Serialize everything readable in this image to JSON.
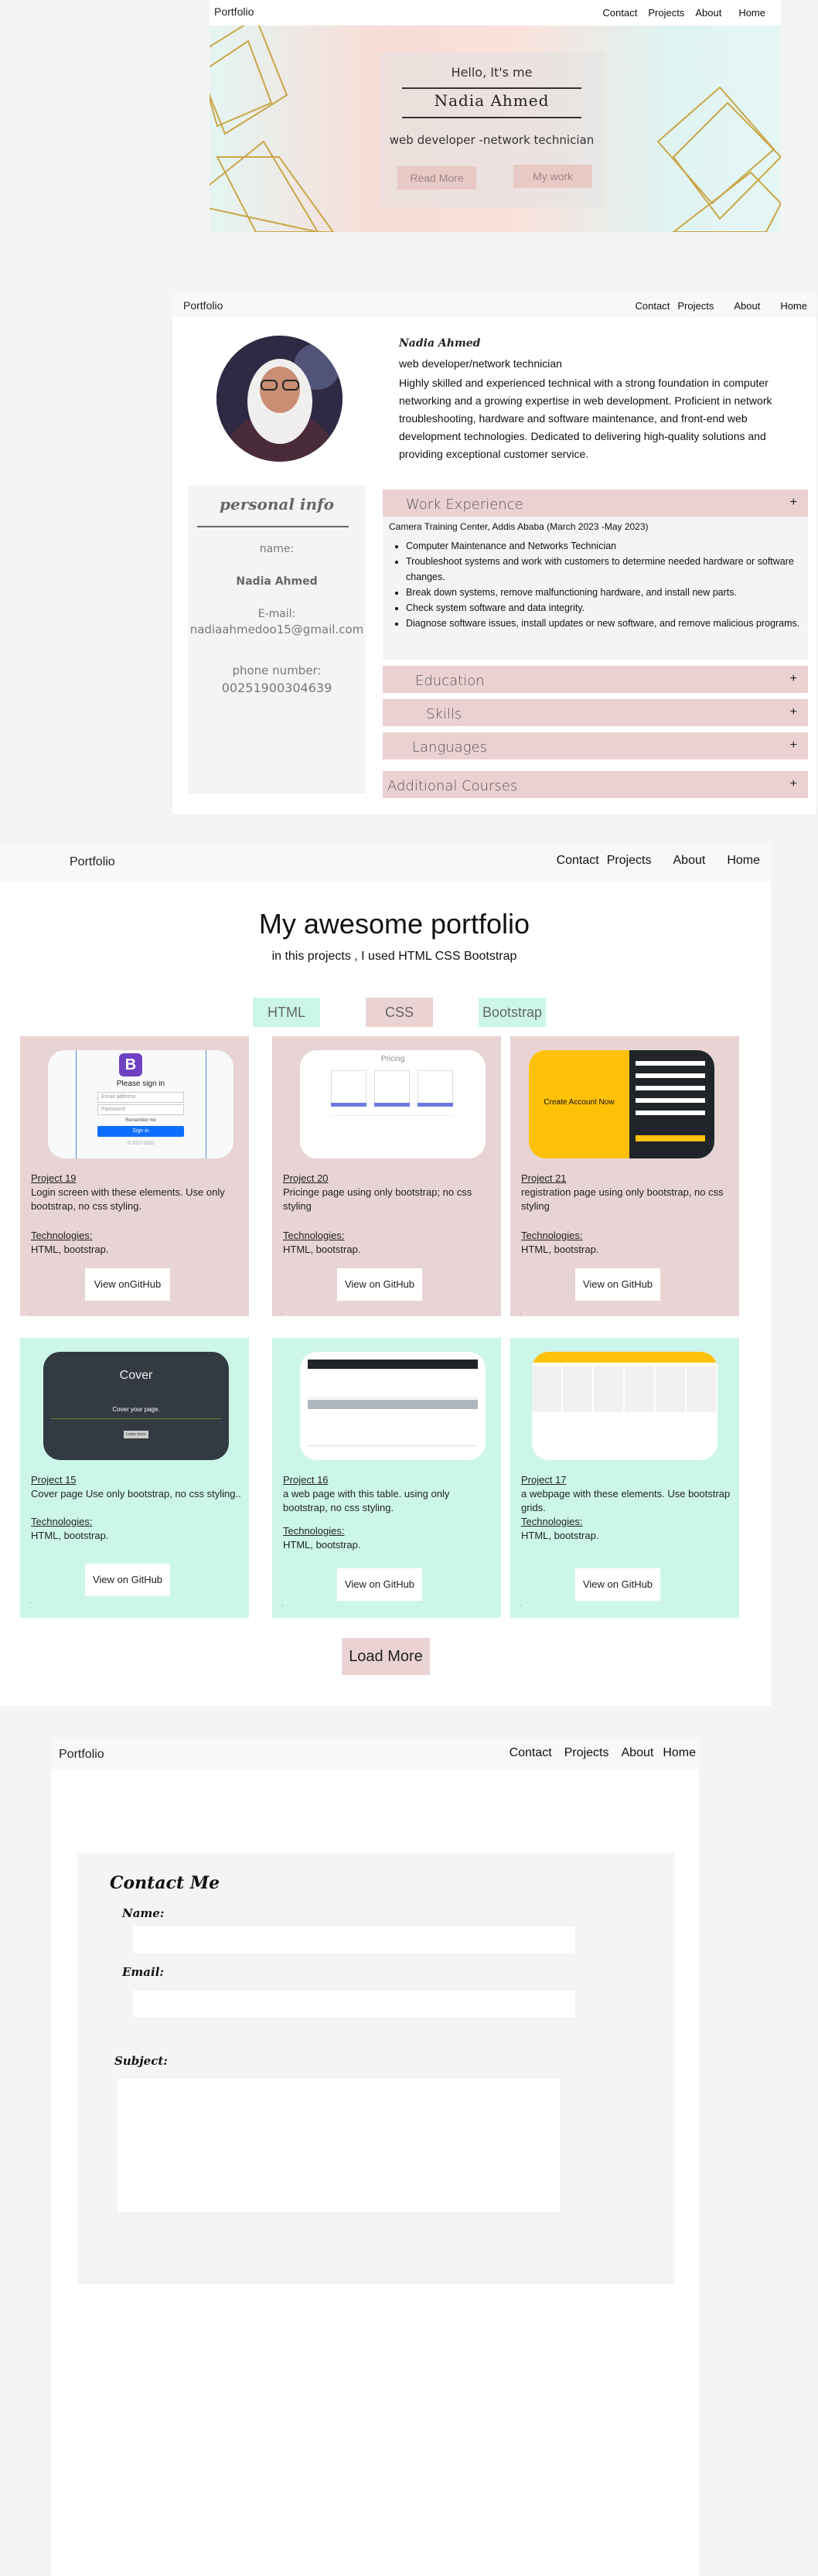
{
  "hero": {
    "brand": "Portfolio",
    "nav": [
      "Contact",
      "Projects",
      "About",
      "Home"
    ],
    "greeting": "Hello, It's me",
    "name": "Nadia Ahmed",
    "role": "web developer -network technician",
    "read_more": "Read More",
    "my_work": "My work"
  },
  "about": {
    "brand": "Portfolio",
    "nav": [
      "Contact",
      "Projects",
      "About",
      "Home"
    ],
    "name": "Nadia Ahmed",
    "role": "web developer/network technician",
    "bio": "Highly skilled and experienced technical with a strong foundation in computer networking and a growing expertise in web development. Proficient in network troubleshooting, hardware and software maintenance, and front-end web development technologies. Dedicated to delivering high-quality solutions and providing exceptional customer service.",
    "personal_info_title": "personal info",
    "name_label": "name:",
    "name_value": "Nadia Ahmed",
    "email_label": "E-mail:",
    "email_value": "nadiaahmedoo15@gmail.com",
    "phone_label": "phone number:",
    "phone_value": "00251900304639",
    "accordions": {
      "work": "Work Experience",
      "education": "Education",
      "skills": "Skills",
      "languages": "Languages",
      "courses": "Additional Courses",
      "plus": "+"
    },
    "work_heading": "Camera Training Center, Addis Ababa (March 2023 -May 2023)",
    "work_items": [
      "Computer Maintenance and Networks Technician",
      "Troubleshoot systems and work with customers to determine needed hardware or software changes.",
      "Break down systems, remove malfunctioning hardware, and install new parts.",
      "Check system software and data integrity.",
      "Diagnose software issues, install updates or new software, and remove malicious programs."
    ]
  },
  "portfolio": {
    "brand": "Portfolio",
    "nav": [
      "Contact",
      "Projects",
      "About",
      "Home"
    ],
    "title": "My awesome portfolio",
    "subtitle": "in this projects , I used HTML CSS  Bootstrap",
    "tabs": [
      "HTML",
      "CSS",
      "Bootstrap"
    ],
    "tech_label": "Technologies:",
    "tech_value": "HTML,  bootstrap.",
    "github_label": "View on GitHub",
    "github_label_first": "View onGitHub",
    "projects": [
      {
        "title": "Project 19",
        "desc": " Login screen with these elements. Use only bootstrap, no css styling."
      },
      {
        "title": "Project 20",
        "desc": "Pricinge page using only bootstrap; no css styling"
      },
      {
        "title": "Project 21",
        "desc": "registration page using only bootstrap, no css styling"
      },
      {
        "title": "Project 15",
        "desc": "Cover  page Use only bootstrap, no css styling.."
      },
      {
        "title": "Project 16",
        "desc": "a web page with this table. using only bootstrap, no css styling."
      },
      {
        "title": "Project 17",
        "desc": "a webpage with these elements. Use bootstrap grids."
      }
    ],
    "load_more": "Load More",
    "shots": {
      "signin_title": "Please sign in",
      "signin_email": "Email address",
      "signin_password": "Password",
      "signin_remember": "Remember me",
      "signin_button": "Sign in",
      "signin_footer": "© 2017-2022",
      "pricing_title": "Pricing",
      "create_account": "Create Account Now",
      "cover_title": "Cover",
      "cover_sub": "Cover your page.",
      "cover_btn": "Learn more"
    }
  },
  "contact": {
    "brand": "Portfolio",
    "nav": [
      "Contact",
      "Projects",
      "About",
      "Home"
    ],
    "title": "Contact Me",
    "name_label": "Name:",
    "email_label": "Email:",
    "subject_label": "Subject:"
  }
}
